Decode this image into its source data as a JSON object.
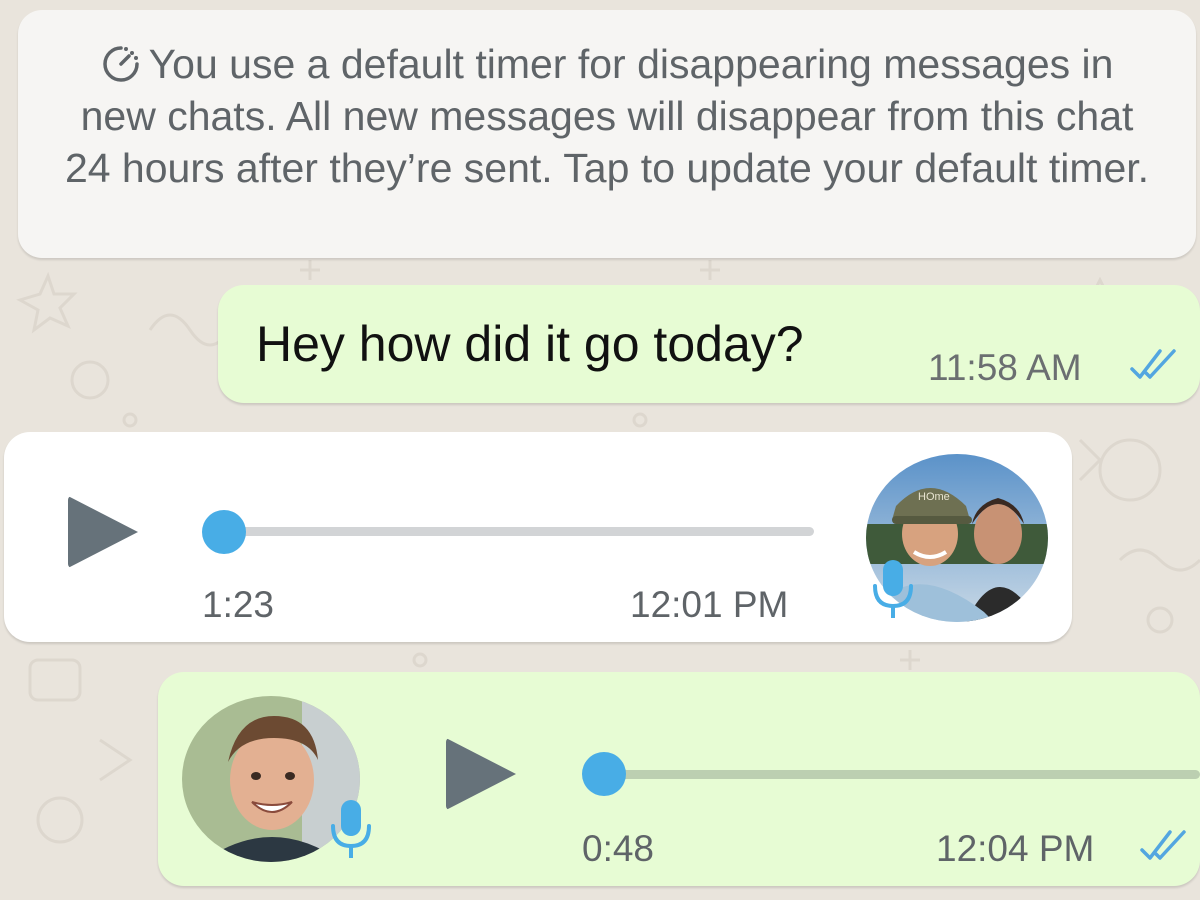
{
  "system_note": {
    "icon": "timer-icon",
    "text": "You use a default timer for disappearing messages in new chats. All new messages will disappear from this chat 24 hours after they’re sent. Tap to update your default timer."
  },
  "messages": [
    {
      "direction": "outgoing",
      "type": "text",
      "text": "Hey how did it go today?",
      "time": "11:58 AM",
      "status_icon": "double-check-read-icon"
    },
    {
      "direction": "incoming",
      "type": "voice",
      "duration": "1:23",
      "time": "12:01 PM",
      "progress": 0,
      "avatar": "contact-avatar",
      "avatar_cap_text": "HOme"
    },
    {
      "direction": "outgoing",
      "type": "voice",
      "duration": "0:48",
      "time": "12:04 PM",
      "progress": 0,
      "avatar": "own-avatar",
      "status_icon": "double-check-read-icon"
    }
  ],
  "colors": {
    "wallpaper": "#e9e4dc",
    "outgoing_bubble": "#e7fcd4",
    "incoming_bubble": "#ffffff",
    "accent_blue": "#48ade6",
    "play_icon": "#66727a"
  }
}
